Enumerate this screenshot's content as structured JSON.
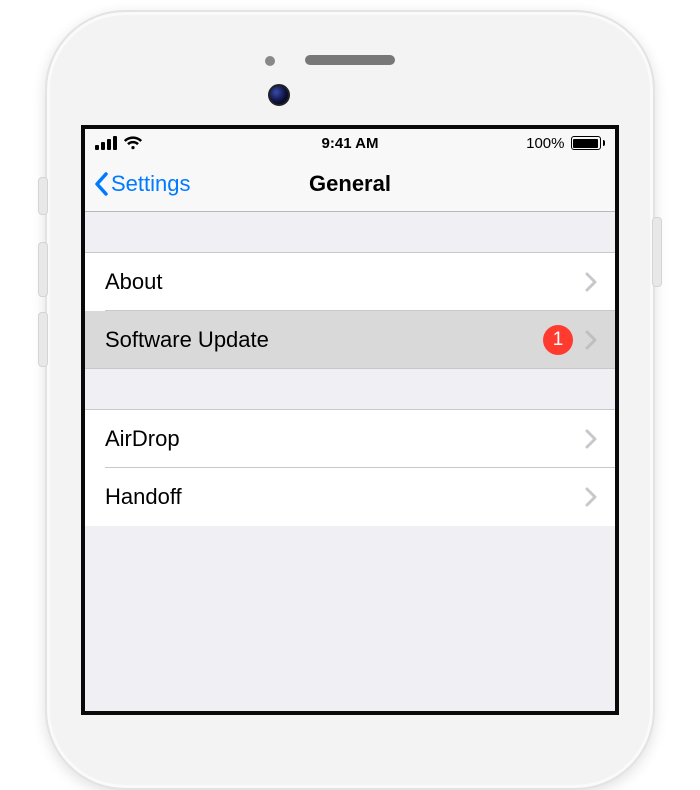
{
  "status": {
    "time": "9:41 AM",
    "battery_text": "100%"
  },
  "nav": {
    "back_label": "Settings",
    "title": "General"
  },
  "group1": {
    "row0": {
      "label": "About"
    },
    "row1": {
      "label": "Software Update",
      "badge": "1"
    }
  },
  "group2": {
    "row0": {
      "label": "AirDrop"
    },
    "row1": {
      "label": "Handoff"
    }
  },
  "colors": {
    "tint": "#007aff",
    "badge": "#ff3b30",
    "group_bg": "#efeff4"
  }
}
